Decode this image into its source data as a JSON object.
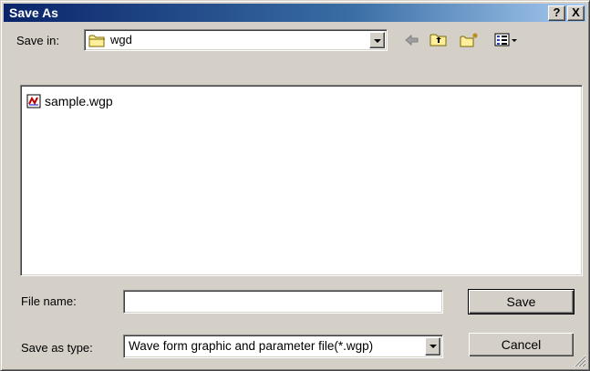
{
  "window": {
    "title": "Save As",
    "help_label": "?",
    "close_label": "X"
  },
  "save_in": {
    "label": "Save in:",
    "value": "wgd"
  },
  "toolbar": {
    "back_icon": "back-arrow-icon",
    "up_icon": "up-one-level-icon",
    "new_folder_icon": "new-folder-icon",
    "view_icon": "view-menu-icon"
  },
  "files": [
    {
      "name": "sample.wgp",
      "icon": "wgp-file-icon"
    }
  ],
  "file_name": {
    "label": "File name:",
    "value": ""
  },
  "save_as_type": {
    "label": "Save as type:",
    "value": "Wave form graphic and parameter file(*.wgp)"
  },
  "buttons": {
    "save": "Save",
    "cancel": "Cancel"
  }
}
